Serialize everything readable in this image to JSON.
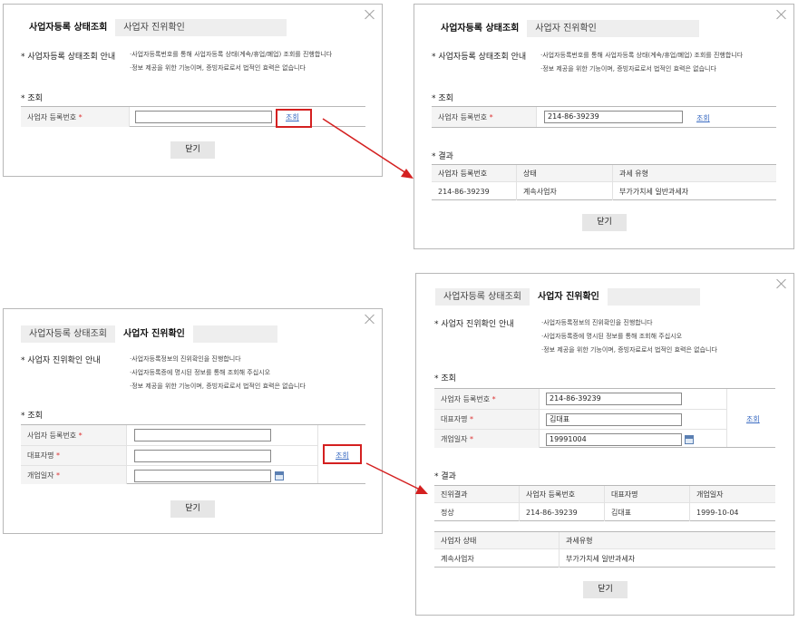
{
  "tabs": {
    "status": "사업자등록 상태조회",
    "verify": "사업자 진위확인"
  },
  "common": {
    "required_mark": "*",
    "query_section": "* 조회",
    "result_section": "* 결과",
    "query_button": "조회",
    "close_button": "닫기"
  },
  "status_dialog": {
    "guide_title": "* 사업자등록 상태조회 안내",
    "guide_lines": [
      "·사업자등록번호를 통해 사업자등록 상태(계속/휴업/폐업) 조회를 진행합니다",
      "·정보 제공을 위한 기능이며, 증빙자료로서 법적인 효력은 없습니다"
    ],
    "field_label": "사업자 등록번호",
    "filled_value": "214-86-39239",
    "result_headers": [
      "사업자 등록번호",
      "상태",
      "과세 유형"
    ],
    "result_row": [
      "214-86-39239",
      "계속사업자",
      "부가가치세 일반과세자"
    ]
  },
  "verify_dialog": {
    "guide_title": "* 사업자 진위확인 안내",
    "guide_lines": [
      "·사업자등록정보의 진위확인을 진행합니다",
      "·사업자등록증에 명시된 정보를 통해 조회해 주십시오",
      "·정보 제공을 위한 기능이며, 증빙자료로서 법적인 효력은 없습니다"
    ],
    "field_labels": [
      "사업자 등록번호",
      "대표자명",
      "개업일자"
    ],
    "filled_values": [
      "214-86-39239",
      "김대표",
      "19991004"
    ],
    "result_headers": [
      "진위결과",
      "사업자 등록번호",
      "대표자명",
      "개업일자"
    ],
    "result_row": [
      "정상",
      "214-86-39239",
      "김대표",
      "1999-10-04"
    ],
    "status_headers": [
      "사업자 상태",
      "과세유형"
    ],
    "status_row": [
      "계속사업자",
      "부가가치세 일반과세자"
    ]
  },
  "colors": {
    "highlight": "#d42020",
    "link": "#3a6bc2",
    "required": "#dd3333"
  }
}
